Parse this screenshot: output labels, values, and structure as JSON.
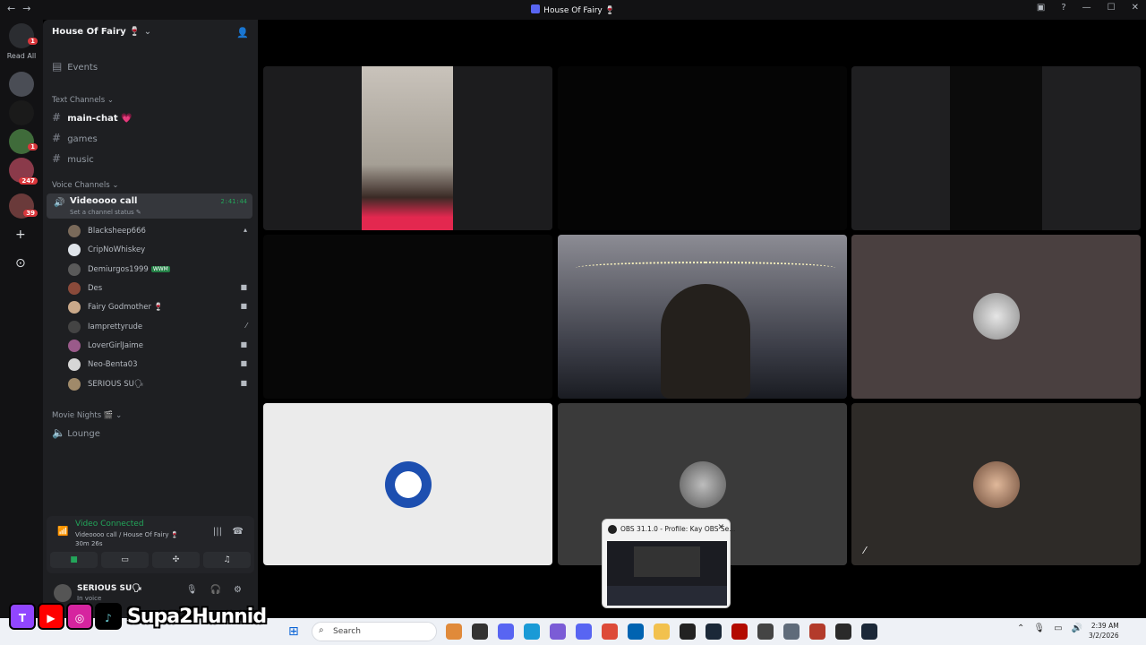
{
  "window": {
    "title": "House Of Fairy 🍷",
    "back": "←",
    "forward": "→",
    "controls": [
      "—",
      "☐",
      "✕"
    ]
  },
  "rail": {
    "read_all": "Read All",
    "badges": [
      "1",
      "1",
      "247",
      "39"
    ]
  },
  "server": {
    "name": "House Of Fairy 🍷",
    "events": "Events",
    "text_category": "Text Channels",
    "text_channels": [
      "main-chat 💗",
      "games",
      "music"
    ],
    "voice_category": "Voice Channels",
    "voice_channel": {
      "name": "Videoooo call",
      "status": "Set a channel status ✎",
      "timer": "2:41:44"
    },
    "members": [
      {
        "name": "Blacksheep666",
        "icon": "▴"
      },
      {
        "name": "CripNoWhiskey",
        "icon": ""
      },
      {
        "name": "Demiurgos1999",
        "tag": "WWM",
        "icon": ""
      },
      {
        "name": "Des",
        "icon": "■"
      },
      {
        "name": "Fairy Godmother 🍷",
        "icon": "■"
      },
      {
        "name": "Iamprettyrude",
        "icon": "⁄"
      },
      {
        "name": "LoverGirlJaime",
        "icon": "■"
      },
      {
        "name": "Neo-Benta03",
        "icon": "■"
      },
      {
        "name": "SERIOUS SU🗣",
        "icon": "■"
      }
    ],
    "movie_category": "Movie Nights 🎬",
    "lounge": "Lounge"
  },
  "voice_panel": {
    "status": "Video Connected",
    "channel": "Videoooo call / House Of Fairy 🍷",
    "duration": "30m 26s"
  },
  "user": {
    "name": "SERIOUS SU🗣",
    "status": "In voice"
  },
  "overlay": {
    "handle": "Supa2Hunnid"
  },
  "obs_popup": {
    "title": "OBS 31.1.0 - Profile: Kay OBS Se...",
    "close": "✕"
  },
  "taskbar": {
    "search_placeholder": "Search",
    "time": "2:39 AM",
    "date": "3/2/2026"
  },
  "colors": {
    "accent_green": "#23a55a",
    "discord_blurple": "#5865f2",
    "badge_red": "#da373c"
  }
}
